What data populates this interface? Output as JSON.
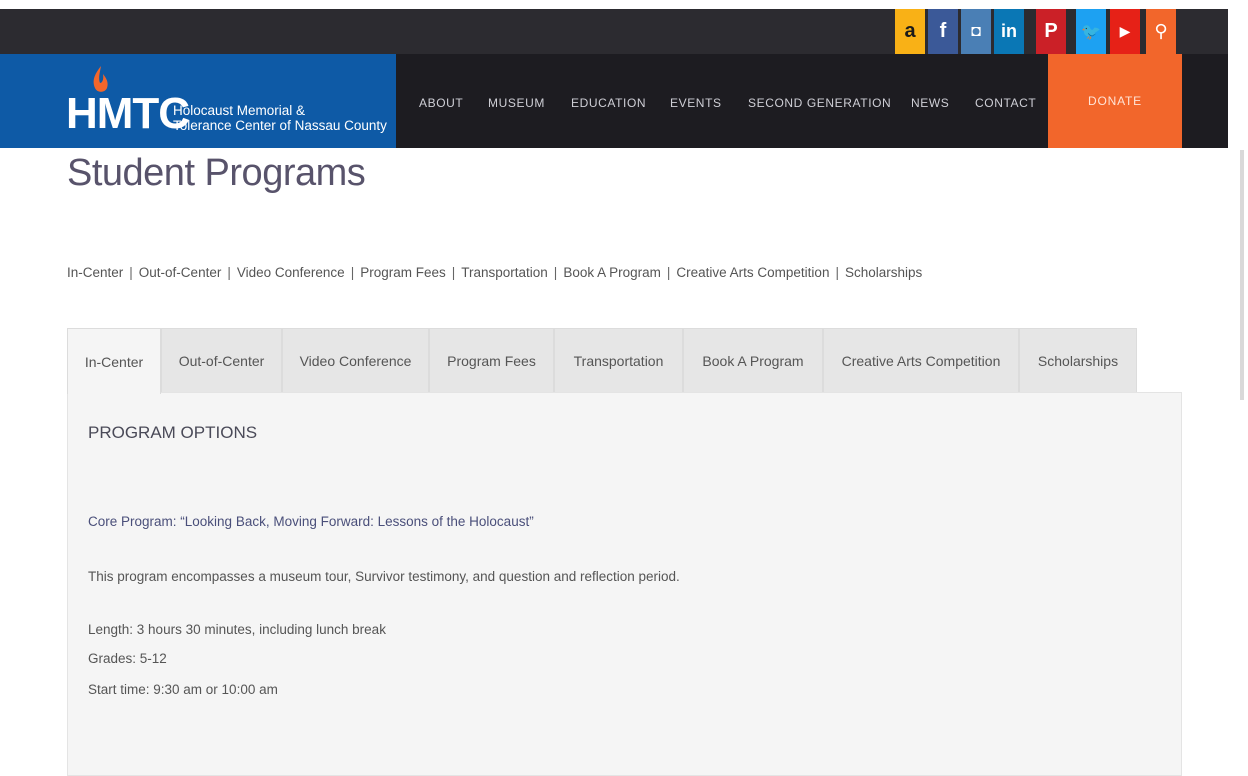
{
  "social": {
    "icons": [
      "amazon-icon",
      "facebook-icon",
      "instagram-icon",
      "linkedin-icon",
      "pinterest-icon",
      "twitter-icon",
      "youtube-icon",
      "search-icon"
    ],
    "glyphs": [
      "a",
      "f",
      "◘",
      "in",
      "P",
      "🐦",
      "▶",
      "⚲"
    ],
    "colors": [
      "#f9b116",
      "#3b5998",
      "#4a7fb5",
      "#0a77b5",
      "#cb2027",
      "#1da1f2",
      "#e62117",
      "#f2662b"
    ]
  },
  "logo": {
    "mark": "HMTC",
    "line1": "Holocaust Memorial &",
    "line2": "Tolerance Center of Nassau County"
  },
  "nav": {
    "items": [
      "ABOUT",
      "MUSEUM",
      "EDUCATION",
      "EVENTS",
      "SECOND GENERATION",
      "NEWS",
      "CONTACT"
    ],
    "donate": "DONATE"
  },
  "page": {
    "title": "Student Programs",
    "quick_links": [
      "In-Center",
      "Out-of-Center",
      "Video Conference",
      "Program Fees",
      "Transportation",
      "Book A Program",
      "Creative Arts Competition",
      "Scholarships"
    ]
  },
  "tabs": {
    "items": [
      "In-Center",
      "Out-of-Center",
      "Video Conference",
      "Program Fees",
      "Transportation",
      "Book A Program",
      "Creative Arts Competition",
      "Scholarships"
    ],
    "active": "In-Center"
  },
  "panel": {
    "heading": "PROGRAM OPTIONS",
    "core": "Core Program: “Looking Back, Moving Forward: Lessons of the Holocaust”",
    "description": "This program encompasses a museum tour, Survivor testimony, and question and reflection period.",
    "length": "Length: 3 hours 30 minutes, including lunch break",
    "grades": "Grades: 5-12",
    "start": "Start time: 9:30 am or 10:00 am"
  },
  "colors": {
    "topbar": "#2c2b30",
    "header": "#1d1c21",
    "logo_bg": "#0e5aa6",
    "donate_bg": "#f2662b",
    "title": "#58536b"
  }
}
